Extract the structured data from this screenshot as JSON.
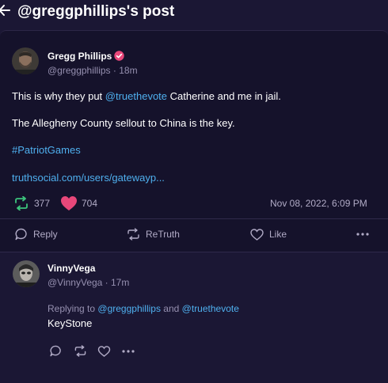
{
  "header": {
    "title": "@greggphillips's post"
  },
  "post": {
    "author_name": "Gregg Phillips",
    "author_handle": "@greggphillips · 18m",
    "line1_prefix": "This is why they put ",
    "line1_mention": "@truethevote",
    "line1_suffix": " Catherine and me in jail.",
    "line2": "The Allegheny County sellout to China is the key.",
    "hashtag": "#PatriotGames",
    "link": "truthsocial.com/users/gatewayp...",
    "retruth_count": "377",
    "like_count": "704",
    "timestamp": "Nov 08, 2022, 6:09 PM",
    "actions": {
      "reply": "Reply",
      "retruth": "ReTruth",
      "like": "Like"
    }
  },
  "reply": {
    "author_name": "VinnyVega",
    "author_handle": "@VinnyVega · 17m",
    "replying_label": "Replying to",
    "replying_to_1": "@greggphillips",
    "replying_and": "and",
    "replying_to_2": "@truethevote",
    "text": "KeyStone"
  },
  "colors": {
    "background": "#1b1734",
    "card": "#15122b",
    "link": "#4fb0ef",
    "retruth_green": "#3cc47c",
    "heart_pink": "#e8477a",
    "verified_badge": "#e8477a"
  }
}
